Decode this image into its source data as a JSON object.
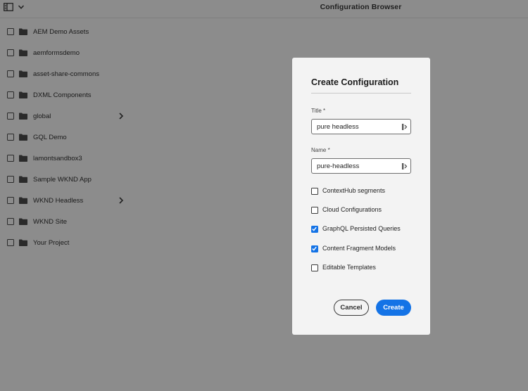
{
  "header": {
    "title": "Configuration Browser",
    "rail_toggle_icon": "rail-toggle-icon",
    "menu_chevron_icon": "chevron-down-icon"
  },
  "configurations": [
    {
      "label": "AEM Demo Assets",
      "has_children": false
    },
    {
      "label": "aemformsdemo",
      "has_children": false
    },
    {
      "label": "asset-share-commons",
      "has_children": false
    },
    {
      "label": "DXML Components",
      "has_children": false
    },
    {
      "label": "global",
      "has_children": true
    },
    {
      "label": "GQL Demo",
      "has_children": false
    },
    {
      "label": "lamontsandbox3",
      "has_children": false
    },
    {
      "label": "Sample WKND App",
      "has_children": false
    },
    {
      "label": "WKND Headless",
      "has_children": true
    },
    {
      "label": "WKND Site",
      "has_children": false
    },
    {
      "label": "Your Project",
      "has_children": false
    }
  ],
  "dialog": {
    "heading": "Create Configuration",
    "title_field": {
      "label": "Title *",
      "value": "pure headless"
    },
    "name_field": {
      "label": "Name *",
      "value": "pure-headless"
    },
    "options": [
      {
        "label": "ContextHub segments",
        "checked": false
      },
      {
        "label": "Cloud Configurations",
        "checked": false
      },
      {
        "label": "GraphQL Persisted Queries",
        "checked": true
      },
      {
        "label": "Content Fragment Models",
        "checked": true
      },
      {
        "label": "Editable Templates",
        "checked": false
      }
    ],
    "cancel_label": "Cancel",
    "create_label": "Create"
  },
  "colors": {
    "backdrop": "#8c8c8c",
    "dialog_bg": "#f3f3f3",
    "accent": "#1473e6"
  }
}
